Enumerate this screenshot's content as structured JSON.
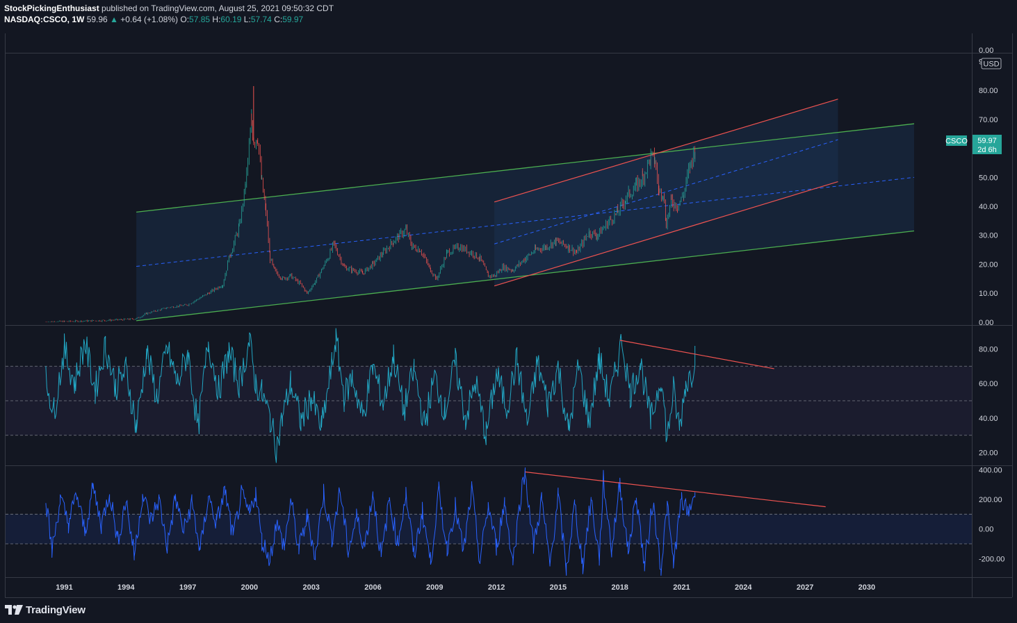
{
  "header": {
    "author": "StockPickingEnthusiast",
    "published": "published on TradingView.com, August 25, 2021 09:50:32 CDT",
    "symbol": "NASDAQ:CSCO, 1W",
    "price": "59.96",
    "change": "+0.64 (+1.08%)",
    "open_label": "O:",
    "open": "57.85",
    "high_label": "H:",
    "high": "60.19",
    "low_label": "L:",
    "low": "57.74",
    "close_label": "C:",
    "close": "59.97"
  },
  "currency": "USD",
  "price_tag": {
    "symbol": "CSCO",
    "value": "59.97",
    "countdown": "2d 6h"
  },
  "logo": {
    "text": "TradingView"
  },
  "colors": {
    "background": "#131722",
    "up": "#26a69a",
    "down": "#ef5350",
    "channel_green": "#4caf50",
    "channel_red": "#ef5350",
    "midline": "#2962ff",
    "rsi": "#22a7c4",
    "cci": "#2962ff"
  },
  "chart_data": [
    {
      "type": "candlestick",
      "name": "price",
      "x_unit": "year",
      "y_ticks": [
        "0.00",
        "10.00",
        "20.00",
        "30.00",
        "40.00",
        "50.00",
        "60.00",
        "70.00",
        "80.00",
        "90.00"
      ],
      "ylim": [
        -1,
        93
      ],
      "top_label": "0.00",
      "x": [
        1990.1,
        1991,
        1992,
        1993,
        1994.2,
        1994.5,
        1995,
        1996,
        1997,
        1998,
        1998.7,
        1999,
        1999.5,
        1999.8,
        2000.1,
        2000.2,
        2000.4,
        2000.6,
        2000.8,
        2001,
        2001.2,
        2001.6,
        2002,
        2002.5,
        2002.8,
        2003.2,
        2003.8,
        2004.1,
        2004.6,
        2005,
        2005.5,
        2006,
        2006.5,
        2007,
        2007.6,
        2007.9,
        2008.3,
        2008.8,
        2009.1,
        2009.6,
        2010.2,
        2010.8,
        2011.2,
        2011.6,
        2011.9,
        2012.3,
        2012.8,
        2013.4,
        2013.9,
        2014.4,
        2014.9,
        2015.5,
        2015.9,
        2016.5,
        2016.9,
        2017.5,
        2017.9,
        2018.3,
        2018.8,
        2019.1,
        2019.5,
        2019.7,
        2019.9,
        2020.1,
        2020.25,
        2020.5,
        2020.8,
        2021.1,
        2021.4,
        2021.65
      ],
      "close": [
        0.1,
        0.2,
        0.4,
        0.6,
        1.0,
        1.2,
        3,
        5,
        6,
        10,
        13,
        22,
        33,
        47,
        69,
        63,
        64,
        48,
        38,
        22,
        18,
        15,
        16,
        13,
        10,
        14,
        22,
        27,
        19,
        18,
        17,
        20,
        24,
        28,
        32,
        26,
        25,
        18,
        15,
        24,
        26,
        24,
        22,
        16,
        16,
        19,
        18,
        22,
        25,
        26,
        28,
        26,
        24,
        31,
        30,
        35,
        38,
        43,
        47,
        50,
        57,
        56,
        45,
        45,
        34,
        42,
        40,
        44,
        54,
        60
      ],
      "rsi_ticks": [
        "20.00",
        "40.00",
        "60.00",
        "80.00"
      ],
      "rsi_levels": [
        30,
        50,
        70
      ],
      "rsi_ylim": [
        13,
        93
      ],
      "rsi_x": [
        1990.1,
        1990.5,
        1991,
        1991.5,
        1992,
        1992.5,
        1993,
        1993.5,
        1994,
        1994.5,
        1995,
        1995.5,
        1996,
        1996.5,
        1997,
        1997.5,
        1998,
        1998.5,
        1999,
        1999.5,
        2000,
        2000.3,
        2000.6,
        2001,
        2001.3,
        2001.6,
        2002,
        2002.5,
        2003,
        2003.5,
        2004,
        2004.2,
        2004.6,
        2005,
        2005.5,
        2006,
        2006.5,
        2007,
        2007.5,
        2008,
        2008.5,
        2009,
        2009.5,
        2010,
        2010.5,
        2011,
        2011.5,
        2012,
        2012.5,
        2013,
        2013.5,
        2014,
        2014.5,
        2015,
        2015.5,
        2016,
        2016.5,
        2017,
        2017.5,
        2017.9,
        2018.1,
        2018.5,
        2019,
        2019.5,
        2020,
        2020.3,
        2020.6,
        2020.9,
        2021.2,
        2021.5,
        2021.65
      ],
      "rsi": [
        62,
        44,
        80,
        60,
        84,
        56,
        82,
        58,
        68,
        35,
        78,
        52,
        80,
        60,
        78,
        34,
        84,
        56,
        78,
        60,
        84,
        60,
        54,
        40,
        22,
        40,
        60,
        38,
        52,
        34,
        70,
        86,
        52,
        64,
        40,
        70,
        48,
        76,
        44,
        68,
        36,
        64,
        44,
        72,
        40,
        60,
        30,
        66,
        46,
        74,
        36,
        72,
        48,
        70,
        32,
        70,
        38,
        74,
        50,
        72,
        86,
        54,
        72,
        38,
        64,
        28,
        56,
        34,
        60,
        66,
        77
      ],
      "rsi_trendline": {
        "from": [
          2018.0,
          85
        ],
        "to": [
          2025.5,
          68.5
        ]
      },
      "cci_ticks": [
        "-200.00",
        "0.00",
        "200.00",
        "400.00"
      ],
      "cci_levels": [
        -100,
        100
      ],
      "cci_ylim": [
        -320,
        420
      ],
      "cci_x": [
        1990.1,
        1990.4,
        1990.8,
        1991.2,
        1991.6,
        1992,
        1992.4,
        1992.8,
        1993.2,
        1993.6,
        1994,
        1994.4,
        1994.8,
        1995.2,
        1995.6,
        1996,
        1996.4,
        1996.8,
        1997.2,
        1997.6,
        1998,
        1998.4,
        1998.8,
        1999.2,
        1999.6,
        2000,
        2000.3,
        2000.6,
        2001,
        2001.3,
        2001.7,
        2002,
        2002.4,
        2002.8,
        2003.2,
        2003.6,
        2004,
        2004.4,
        2004.8,
        2005.2,
        2005.6,
        2006,
        2006.4,
        2006.8,
        2007.2,
        2007.6,
        2008,
        2008.4,
        2008.8,
        2009.2,
        2009.6,
        2010,
        2010.4,
        2010.8,
        2011.2,
        2011.6,
        2012,
        2012.4,
        2012.8,
        2013.2,
        2013.4,
        2013.8,
        2014.2,
        2014.6,
        2015,
        2015.4,
        2015.8,
        2016.2,
        2016.6,
        2017,
        2017.2,
        2017.6,
        2018,
        2018.4,
        2018.8,
        2019.2,
        2019.6,
        2020,
        2020.3,
        2020.6,
        2021,
        2021.3,
        2021.65
      ],
      "cci": [
        210,
        -150,
        200,
        40,
        230,
        -20,
        280,
        30,
        250,
        -80,
        200,
        -180,
        230,
        60,
        200,
        -120,
        210,
        -20,
        180,
        -150,
        220,
        40,
        260,
        -60,
        230,
        100,
        250,
        -80,
        -200,
        40,
        -120,
        200,
        -140,
        80,
        -180,
        250,
        -60,
        260,
        -150,
        80,
        -120,
        250,
        -200,
        200,
        -100,
        240,
        -180,
        120,
        -220,
        250,
        -130,
        150,
        -160,
        260,
        -220,
        160,
        -120,
        180,
        -220,
        240,
        390,
        -120,
        200,
        -250,
        230,
        -280,
        160,
        -240,
        200,
        -200,
        330,
        -140,
        310,
        -150,
        220,
        -250,
        180,
        -260,
        150,
        -230,
        200,
        100,
        250
      ],
      "cci_trendline": {
        "from": [
          2013.4,
          385
        ],
        "to": [
          2028.0,
          150
        ]
      }
    }
  ],
  "x_ticks": [
    "1991",
    "1994",
    "1997",
    "2000",
    "2003",
    "2006",
    "2009",
    "2012",
    "2015",
    "2018",
    "2021",
    "2024",
    "2027",
    "2030"
  ],
  "x_tick_values": [
    1991,
    1994,
    1997,
    2000,
    2003,
    2006,
    2009,
    2012,
    2015,
    2018,
    2021,
    2024,
    2027,
    2030
  ],
  "drawings": {
    "green_channel": {
      "x_start": 1994.5,
      "x_end": 2032.3,
      "upper": [
        38,
        68.5
      ],
      "lower": [
        0.5,
        31.5
      ],
      "mid": [
        19.25,
        50
      ]
    },
    "red_channel": {
      "x_start": 2011.9,
      "x_end": 2028.6,
      "upper": [
        41.5,
        77
      ],
      "lower": [
        12.5,
        48.5
      ],
      "mid": [
        27,
        63
      ]
    }
  }
}
